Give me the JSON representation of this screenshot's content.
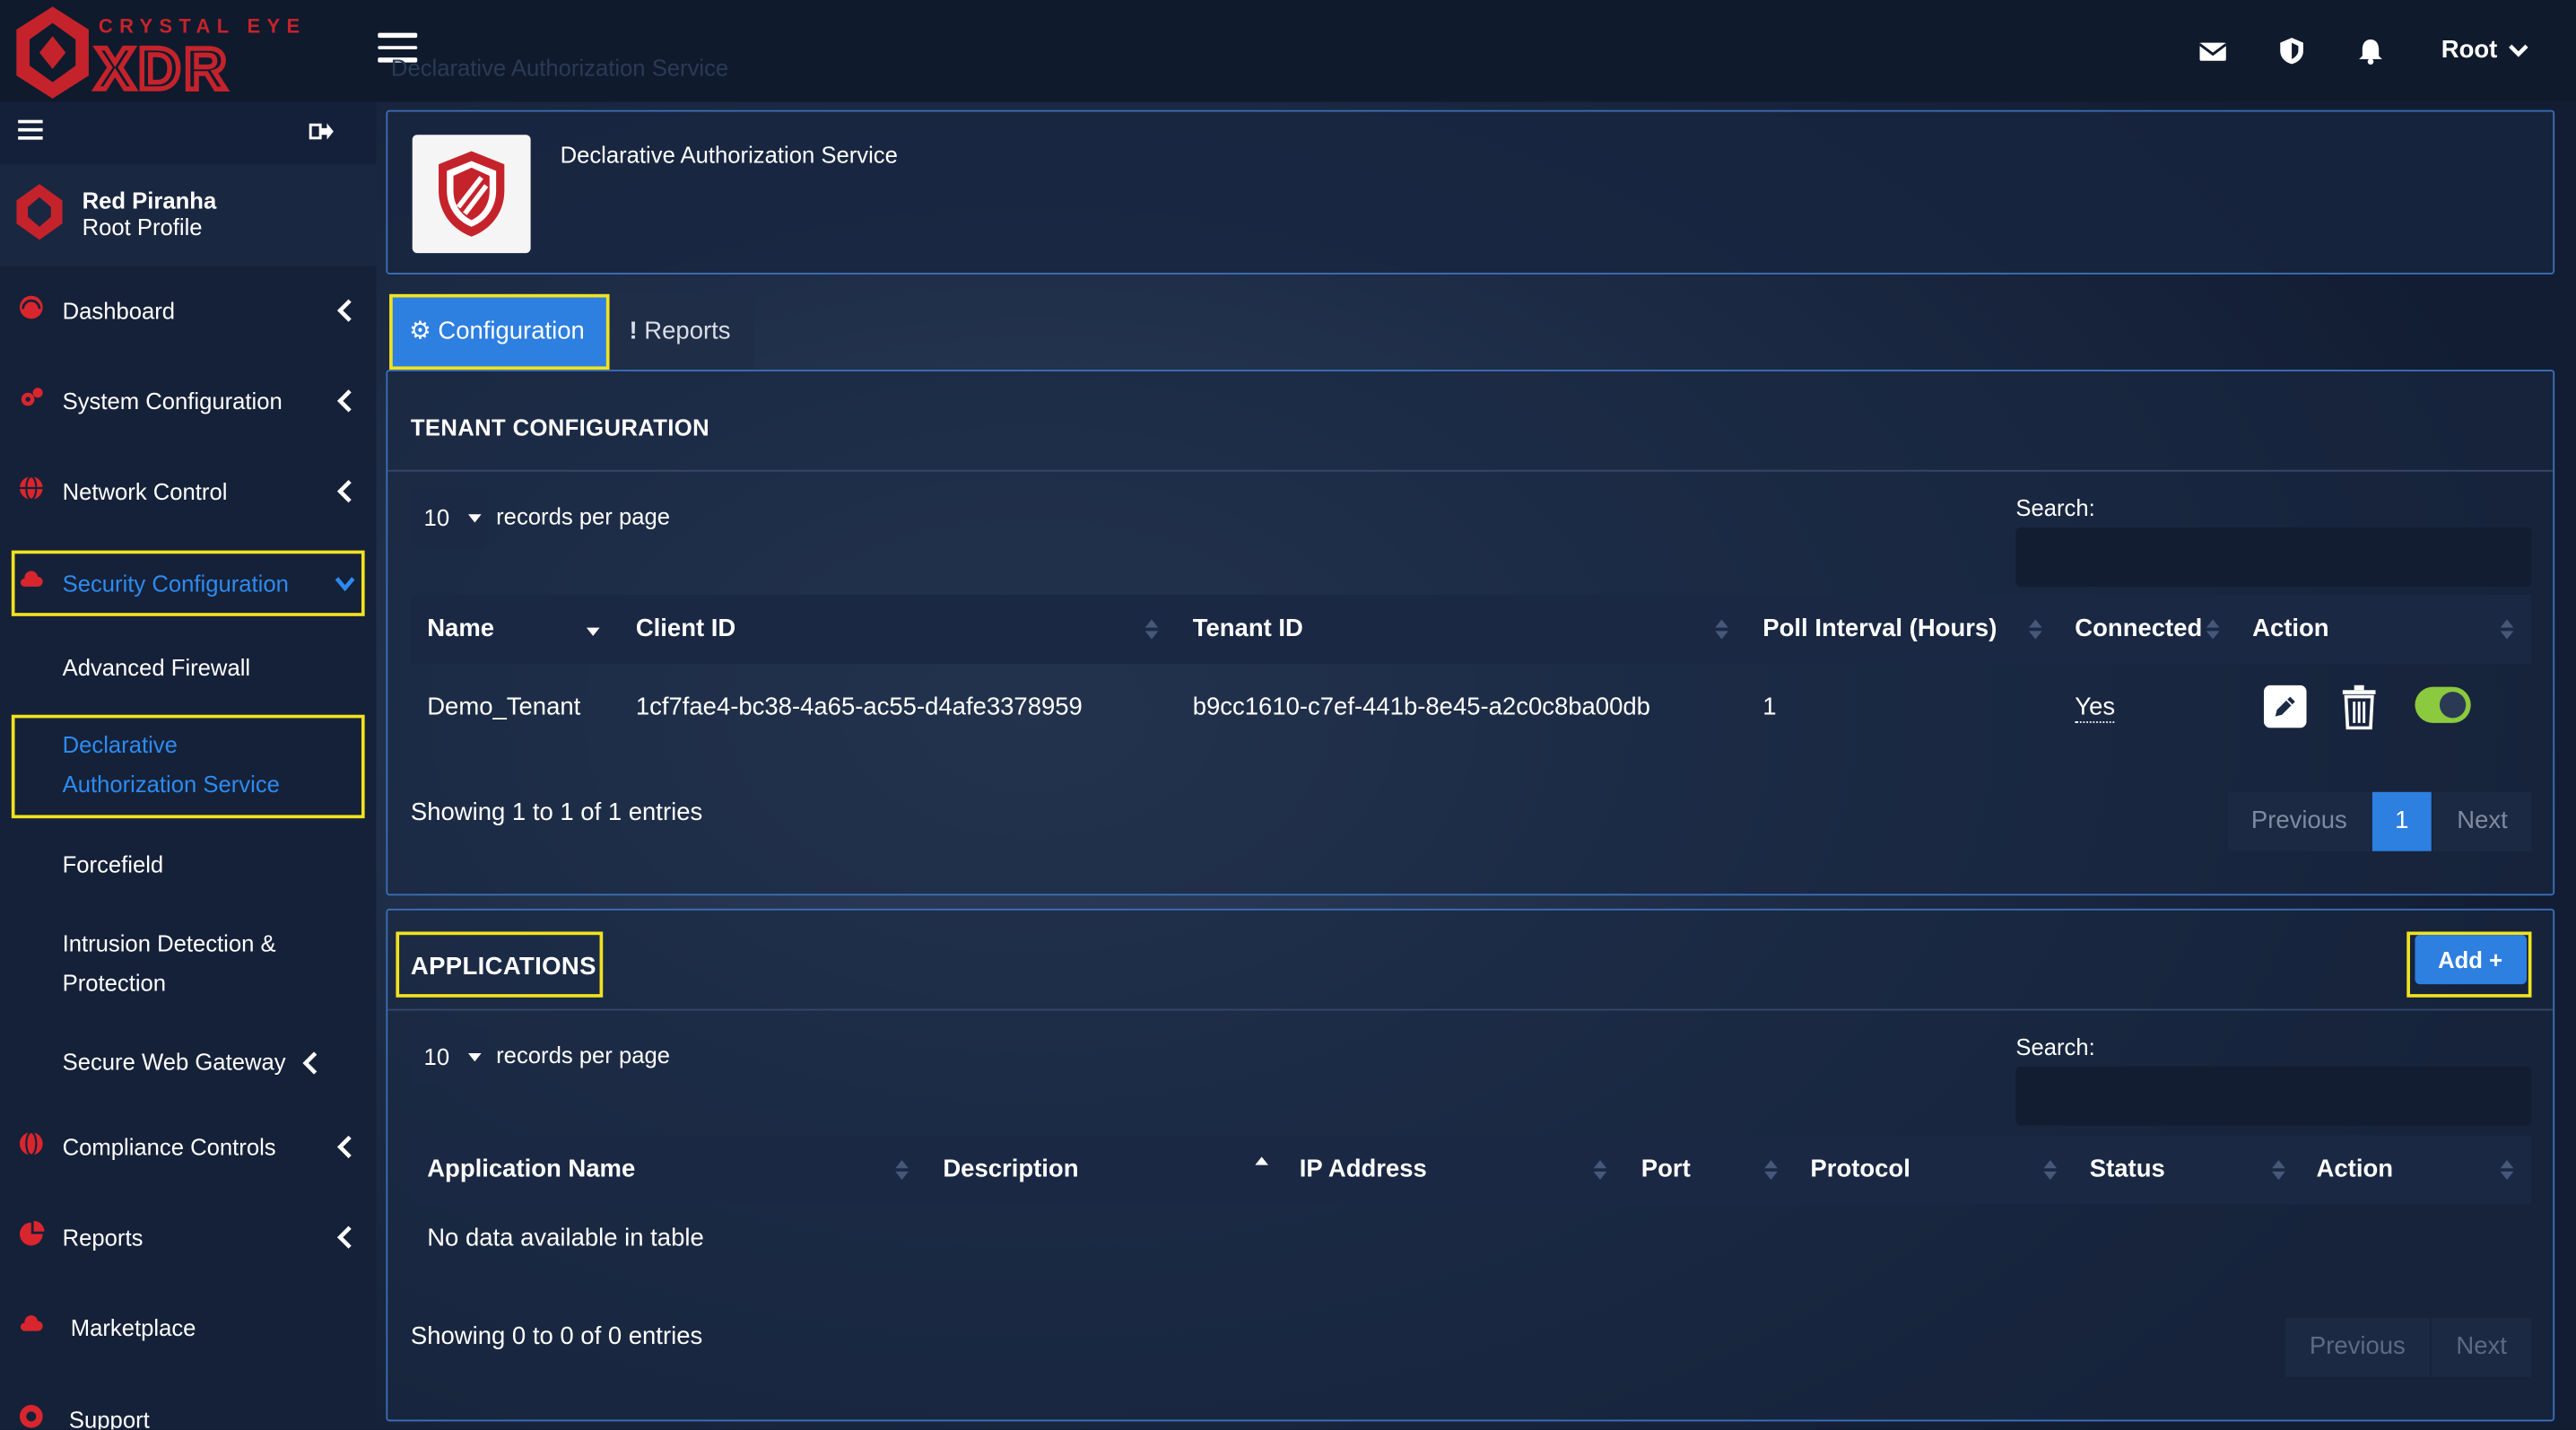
{
  "brand": {
    "top": "CRYSTAL EYE",
    "main": "XDR"
  },
  "topbar": {
    "ghost_title": "Declarative Authorization Service",
    "user_label": "Root"
  },
  "profile": {
    "name": "Red Piranha",
    "role": "Root Profile"
  },
  "sidebar": {
    "items": [
      {
        "label": "Dashboard"
      },
      {
        "label": "System Configuration"
      },
      {
        "label": "Network Control"
      },
      {
        "label": "Security Configuration"
      },
      {
        "label": "Compliance Controls"
      },
      {
        "label": "Reports"
      },
      {
        "label": "Marketplace"
      },
      {
        "label": "Support"
      }
    ],
    "sub_items": [
      {
        "label": "Advanced Firewall"
      },
      {
        "label": "Declarative"
      },
      {
        "label": "Authorization Service"
      },
      {
        "label": "Forcefield"
      },
      {
        "label": "Intrusion Detection &"
      },
      {
        "label": "Protection"
      },
      {
        "label": "Secure Web Gateway"
      }
    ]
  },
  "service": {
    "title": "Declarative Authorization Service"
  },
  "tabs": [
    {
      "label": "Configuration"
    },
    {
      "label": "Reports"
    }
  ],
  "tenant": {
    "heading": "TENANT CONFIGURATION",
    "rpp_value": "10",
    "rpp_text": "records per page",
    "search_label": "Search:",
    "columns": [
      "Name",
      "Client ID",
      "Tenant ID",
      "Poll Interval (Hours)",
      "Connected",
      "Action"
    ],
    "rows": [
      {
        "name": "Demo_Tenant",
        "client_id": "1cf7fae4-bc38-4a65-ac55-d4afe3378959",
        "tenant_id": "b9cc1610-c7ef-441b-8e45-a2c0c8ba00db",
        "poll": "1",
        "connected": "Yes"
      }
    ],
    "showing": "Showing 1 to 1 of 1 entries",
    "pager": {
      "prev": "Previous",
      "current": "1",
      "next": "Next"
    }
  },
  "apps": {
    "heading": "APPLICATIONS",
    "add_label": "Add",
    "rpp_value": "10",
    "rpp_text": "records per page",
    "search_label": "Search:",
    "columns": [
      "Application Name",
      "Description",
      "IP Address",
      "Port",
      "Protocol",
      "Status",
      "Action"
    ],
    "empty": "No data available in table",
    "showing": "Showing 0 to 0 of 0 entries",
    "pager": {
      "prev": "Previous",
      "next": "Next"
    }
  },
  "colors": {
    "accent": "#2d7fe0",
    "highlight": "#f1e21f",
    "brand_red": "#d9262e",
    "toggle_on": "#8bc93e"
  }
}
